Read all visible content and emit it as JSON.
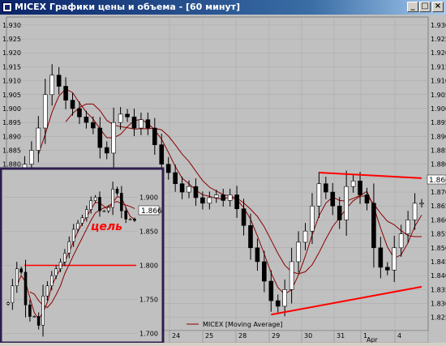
{
  "window": {
    "title": "MICEX Графики цены и объема - [60 минут]",
    "buttons": {
      "minimize": "_",
      "maximize": "□",
      "close": "×"
    }
  },
  "colors": {
    "background": "#c0c0c0",
    "ma_line": "#8b0000",
    "trendlines": "#ff0000",
    "inset_border": "#2e1e4e",
    "up_candle": "#ffffff",
    "down_candle": "#000000"
  },
  "legend": {
    "label": "MICEX [Moving Average]"
  },
  "main_chart": {
    "y_ticks": [
      "1.930",
      "1.925",
      "1.920",
      "1.915",
      "1.910",
      "1.905",
      "1.900",
      "1.895",
      "1.890",
      "1.885",
      "1.880",
      "1.875",
      "1.870",
      "1.865",
      "1.860",
      "1.855",
      "1.850",
      "1.845",
      "1.840",
      "1.835",
      "1.830",
      "1.825"
    ],
    "x_labels": [
      "24",
      "25",
      "28",
      "29",
      "30",
      "31",
      "1",
      "4"
    ],
    "x_sublabel": "Apr",
    "last_price": "1.866"
  },
  "inset_chart": {
    "y_ticks": [
      "1.900",
      "1.850",
      "1.800",
      "1.750",
      "1.700"
    ],
    "last_price": "1.866",
    "annotation": "цель"
  },
  "chart_data": [
    {
      "type": "candlestick",
      "title": "MICEX Графики цены и объема - [60 минут]",
      "ylim": [
        1.822,
        1.932
      ],
      "x_labels": [
        "24",
        "25",
        "28",
        "29",
        "30",
        "31",
        "1 Apr",
        "4"
      ],
      "close_series": [
        1.876,
        1.88,
        1.885,
        1.893,
        1.905,
        1.912,
        1.908,
        1.903,
        1.9,
        1.897,
        1.895,
        1.893,
        1.886,
        1.884,
        1.895,
        1.898,
        1.897,
        1.893,
        1.896,
        1.893,
        1.887,
        1.88,
        1.877,
        1.873,
        1.87,
        1.872,
        1.868,
        1.866,
        1.868,
        1.869,
        1.867,
        1.869,
        1.864,
        1.858,
        1.85,
        1.845,
        1.838,
        1.831,
        1.829,
        1.835,
        1.845,
        1.852,
        1.856,
        1.865,
        1.873,
        1.87,
        1.865,
        1.86,
        1.872,
        1.874,
        1.869,
        1.866,
        1.85,
        1.843,
        1.842,
        1.85,
        1.855,
        1.86,
        1.866,
        1.866
      ],
      "moving_averages": [
        {
          "name": "MICEX [Moving Average]",
          "period": 4
        },
        {
          "name": "MICEX [Moving Average]",
          "period": 8
        }
      ],
      "trendlines": [
        {
          "from": [
            44,
            1.877
          ],
          "to": [
            59,
            1.875
          ]
        },
        {
          "from": [
            37,
            1.826
          ],
          "to": [
            59,
            1.836
          ]
        }
      ],
      "last_price": 1.866
    },
    {
      "type": "candlestick",
      "ylim": [
        1.69,
        1.935
      ],
      "close_series": [
        1.745,
        1.77,
        1.795,
        1.79,
        1.742,
        1.725,
        1.725,
        1.712,
        1.755,
        1.77,
        1.785,
        1.795,
        1.805,
        1.818,
        1.835,
        1.853,
        1.862,
        1.87,
        1.882,
        1.895,
        1.9,
        1.88,
        1.88,
        1.885,
        1.912,
        1.906,
        1.88,
        1.868,
        1.868,
        1.866
      ],
      "target_level": 1.8,
      "annotation": "цель",
      "last_price": 1.866
    }
  ]
}
